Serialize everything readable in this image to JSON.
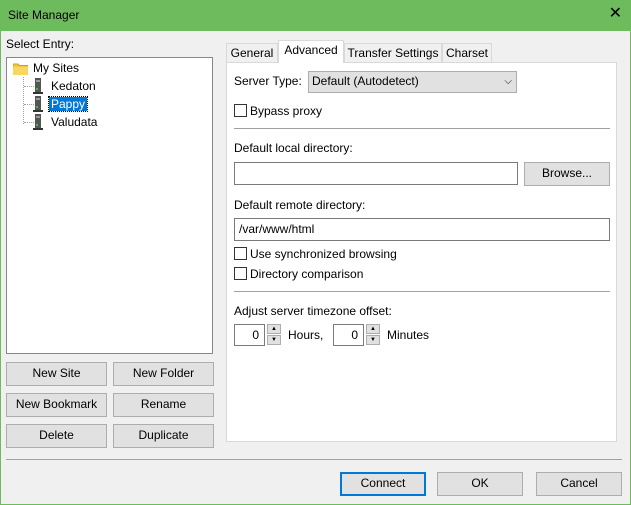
{
  "window": {
    "title": "Site Manager",
    "colors": {
      "frame": "#6dbb5d",
      "selection": "#0078d7",
      "client": "#f0f0f0"
    }
  },
  "left": {
    "select_entry_label": "Select Entry:",
    "tree": {
      "root": "My Sites",
      "items": [
        "Kedaton",
        "Pappy",
        "Valudata"
      ],
      "selected": "Pappy"
    },
    "buttons": {
      "new_site": "New Site",
      "new_folder": "New Folder",
      "new_bookmark": "New Bookmark",
      "rename": "Rename",
      "delete": "Delete",
      "duplicate": "Duplicate"
    }
  },
  "tabs": [
    "General",
    "Advanced",
    "Transfer Settings",
    "Charset"
  ],
  "active_tab": "Advanced",
  "advanced": {
    "server_type_label": "Server Type:",
    "server_type_value": "Default (Autodetect)",
    "bypass_proxy_label": "Bypass proxy",
    "bypass_proxy_checked": false,
    "default_local_dir_label": "Default local directory:",
    "default_local_dir_value": "",
    "browse_label": "Browse...",
    "default_remote_dir_label": "Default remote directory:",
    "default_remote_dir_value": "/var/www/html",
    "sync_browsing_label": "Use synchronized browsing",
    "sync_browsing_checked": false,
    "dir_comparison_label": "Directory comparison",
    "dir_comparison_checked": false,
    "timezone_label": "Adjust server timezone offset:",
    "hours_value": "0",
    "hours_label": "Hours,",
    "minutes_value": "0",
    "minutes_label": "Minutes"
  },
  "footer": {
    "connect": "Connect",
    "ok": "OK",
    "cancel": "Cancel"
  },
  "icons": {
    "close": "close-icon",
    "folder": "folder-icon",
    "server": "server-icon",
    "dropdown": "chevron-down-icon",
    "spin_up": "spin-up-icon",
    "spin_down": "spin-down-icon"
  }
}
